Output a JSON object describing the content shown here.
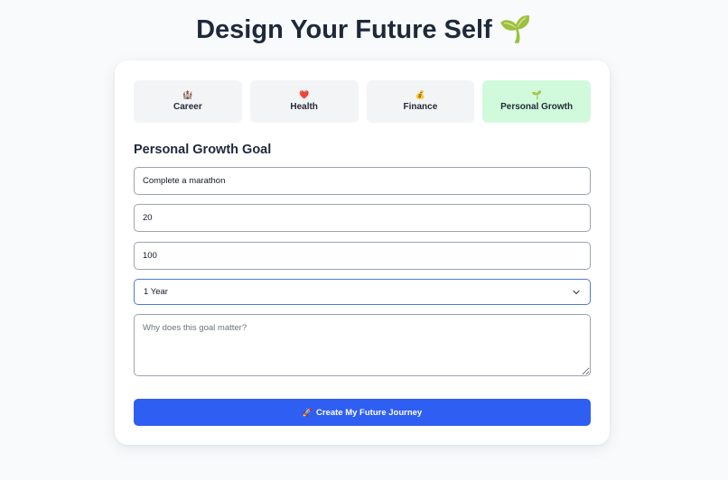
{
  "page": {
    "title": "Design Your Future Self",
    "title_icon": "🌱"
  },
  "tabs": [
    {
      "label": "Career",
      "icon": "🏰",
      "icon_name": "castle-icon",
      "active": false
    },
    {
      "label": "Health",
      "icon": "❤️",
      "icon_name": "heart-icon",
      "active": false
    },
    {
      "label": "Finance",
      "icon": "💰",
      "icon_name": "money-bag-icon",
      "active": false
    },
    {
      "label": "Personal Growth",
      "icon": "🌱",
      "icon_name": "seedling-icon",
      "active": true
    }
  ],
  "form": {
    "section_title": "Personal Growth Goal",
    "goal_value": "Complete a marathon",
    "current_value": "20",
    "target_value": "100",
    "timeframe": {
      "selected": "1 Year"
    },
    "reason_placeholder": "Why does this goal matter?",
    "submit_icon": "🚀",
    "submit_label": "Create My Future Journey"
  },
  "colors": {
    "background": "#f8fafc",
    "card": "#ffffff",
    "tab_inactive": "#f3f4f6",
    "tab_active": "#d1fadc",
    "primary_button": "#2f5ef2",
    "focus_border": "#4b7bd6",
    "text_dark": "#1e293b"
  }
}
